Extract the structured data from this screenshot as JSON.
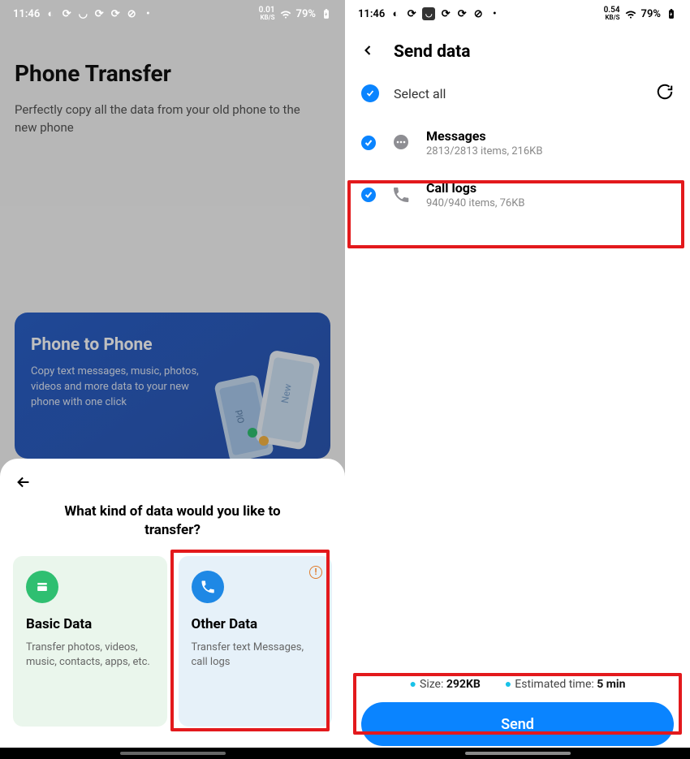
{
  "status": {
    "time": "11:46",
    "battery": "79%",
    "net_left": "0.01",
    "net_right": "0.54",
    "net_unit": "KB/S"
  },
  "left": {
    "title": "Phone Transfer",
    "subtitle": "Perfectly copy all the data from your old phone to the new phone",
    "promo_title": "Phone to Phone",
    "promo_text": "Copy text messages, music, photos, videos and more data to your new phone with one click"
  },
  "sheet": {
    "title": "What kind of data would you like to transfer?",
    "basic_title": "Basic Data",
    "basic_text": "Transfer photos, videos, music, contacts, apps, etc.",
    "other_title": "Other Data",
    "other_text": "Transfer text Messages, call logs"
  },
  "right": {
    "title": "Send data",
    "select_all": "Select all",
    "items": [
      {
        "name": "Messages",
        "meta": "2813/2813 items, 216KB"
      },
      {
        "name": "Call logs",
        "meta": "940/940 items, 76KB"
      }
    ],
    "size_label": "Size:",
    "size_value": "292KB",
    "eta_label": "Estimated time:",
    "eta_value": "5 min",
    "send": "Send"
  }
}
